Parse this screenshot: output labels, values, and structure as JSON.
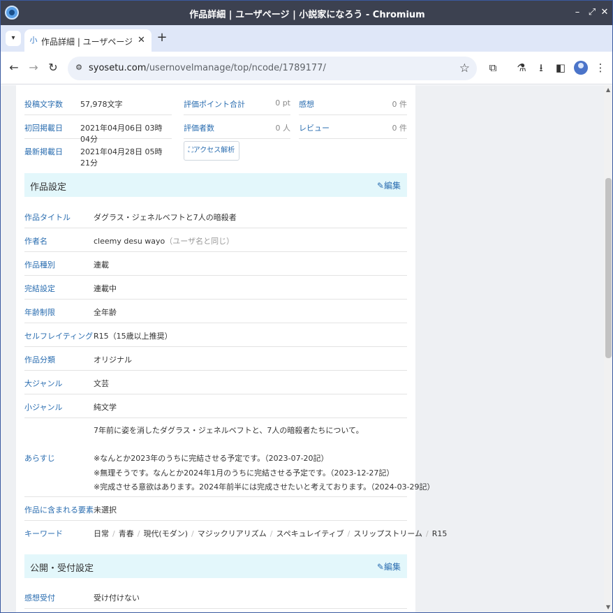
{
  "window": {
    "title": "作品詳細 | ユーザページ | 小説家になろう - Chromium"
  },
  "tab": {
    "title": "作品詳細 | ユーザページ | 小説家になろう",
    "favicon": "小"
  },
  "omnibox": {
    "host": "syosetu.com",
    "path": "/usernovelmanage/top/ncode/1789177/"
  },
  "stats": {
    "char_count_label": "投稿文字数",
    "char_count": "57,978文字",
    "first_post_label": "初回掲載日",
    "first_post": "2021年04月06日 03時04分",
    "last_post_label": "最新掲載日",
    "last_post": "2021年04月28日 05時21分",
    "points_label": "評価ポイント合計",
    "points": "0 pt",
    "raters_label": "評価者数",
    "raters": "0 人",
    "impressions_label": "感想",
    "impressions": "0 件",
    "reviews_label": "レビュー",
    "reviews": "0 件",
    "access_button": "アクセス解析"
  },
  "work_settings": {
    "title": "作品設定",
    "edit": "編集",
    "rows": {
      "title_label": "作品タイトル",
      "title_value": "ダグラス・ジェネルベフトと7人の暗殺者",
      "author_label": "作者名",
      "author_value": "cleemy desu wayo",
      "author_note": "（ユーザ名と同じ）",
      "type_label": "作品種別",
      "type_value": "連載",
      "status_label": "完結設定",
      "status_value": "連載中",
      "age_label": "年齢制限",
      "age_value": "全年齢",
      "selfrating_label": "セルフレイティング",
      "selfrating_value": "R15（15歳以上推奨）",
      "category_label": "作品分類",
      "category_value": "オリジナル",
      "genre_label": "大ジャンル",
      "genre_value": "文芸",
      "subgenre_label": "小ジャンル",
      "subgenre_value": "純文学",
      "synopsis_label": "あらすじ",
      "synopsis": [
        "7年前に姿を消したダグラス・ジェネルベフトと、7人の暗殺者たちについて。",
        "※なんとか2023年のうちに完結させる予定です。（2023-07-20記）",
        "※無理そうです。なんとか2024年1月のうちに完結させる予定です。（2023-12-27記）",
        "※完成させる意欲はあります。2024年前半には完成させたいと考えております。（2024-03-29記）"
      ],
      "elements_label": "作品に含まれる要素",
      "elements_value": "未選択",
      "keywords_label": "キーワード",
      "keywords": [
        "日常",
        "青春",
        "現代(モダン)",
        "マジックリアリズム",
        "スペキュレイティブ",
        "スリップストリーム",
        "R15"
      ]
    }
  },
  "public_settings": {
    "title": "公開・受付設定",
    "edit": "編集",
    "impressions_label": "感想受付",
    "impressions_value": "受け付けない"
  },
  "colors": {
    "link": "#2a6db0",
    "section_bg": "#e3f7fb",
    "titlebar": "#3c4150",
    "tabstrip": "#dfe7f8"
  }
}
